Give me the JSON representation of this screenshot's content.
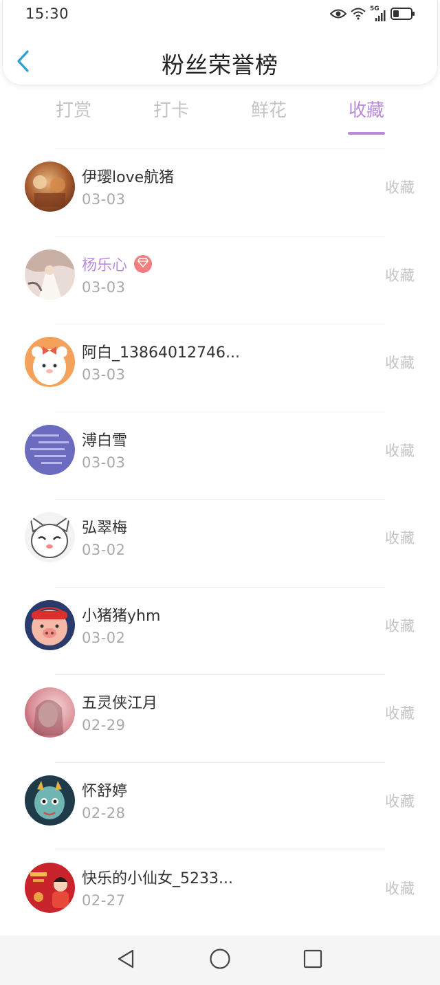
{
  "status_bar": {
    "time": "15:30",
    "network": "5G",
    "icons": [
      "eye-icon",
      "wifi-icon",
      "cellular-signal-icon",
      "battery-icon"
    ]
  },
  "header": {
    "title": "粉丝荣誉榜",
    "back_icon": "chevron-left-icon"
  },
  "tabs": [
    {
      "label": "打赏",
      "active": false
    },
    {
      "label": "打卡",
      "active": false
    },
    {
      "label": "鲜花",
      "active": false
    },
    {
      "label": "收藏",
      "active": true
    }
  ],
  "colors": {
    "accent": "#b98bdc",
    "back_arrow": "#2a9fd8",
    "muted_text": "#c4c4c4",
    "date_text": "#a8a8a8",
    "vip_badge": "#f07f7f"
  },
  "fans": [
    {
      "name": "伊璎love航猪",
      "date": "03-03",
      "action": "收藏",
      "vip": false
    },
    {
      "name": "杨乐心",
      "date": "03-03",
      "action": "收藏",
      "vip": true
    },
    {
      "name": "阿白_13864012746...",
      "date": "03-03",
      "action": "收藏",
      "vip": false
    },
    {
      "name": "溥白雪",
      "date": "03-03",
      "action": "收藏",
      "vip": false
    },
    {
      "name": "弘翠梅",
      "date": "03-02",
      "action": "收藏",
      "vip": false
    },
    {
      "name": "小猪猪yhm",
      "date": "03-02",
      "action": "收藏",
      "vip": false
    },
    {
      "name": "五灵侠江月",
      "date": "02-29",
      "action": "收藏",
      "vip": false
    },
    {
      "name": "怀舒婷",
      "date": "02-28",
      "action": "收藏",
      "vip": false
    },
    {
      "name": "快乐的小仙女_5233...",
      "date": "02-27",
      "action": "收藏",
      "vip": false
    }
  ],
  "nav_bar": {
    "buttons": [
      "back-triangle-icon",
      "home-circle-icon",
      "recents-square-icon"
    ]
  }
}
